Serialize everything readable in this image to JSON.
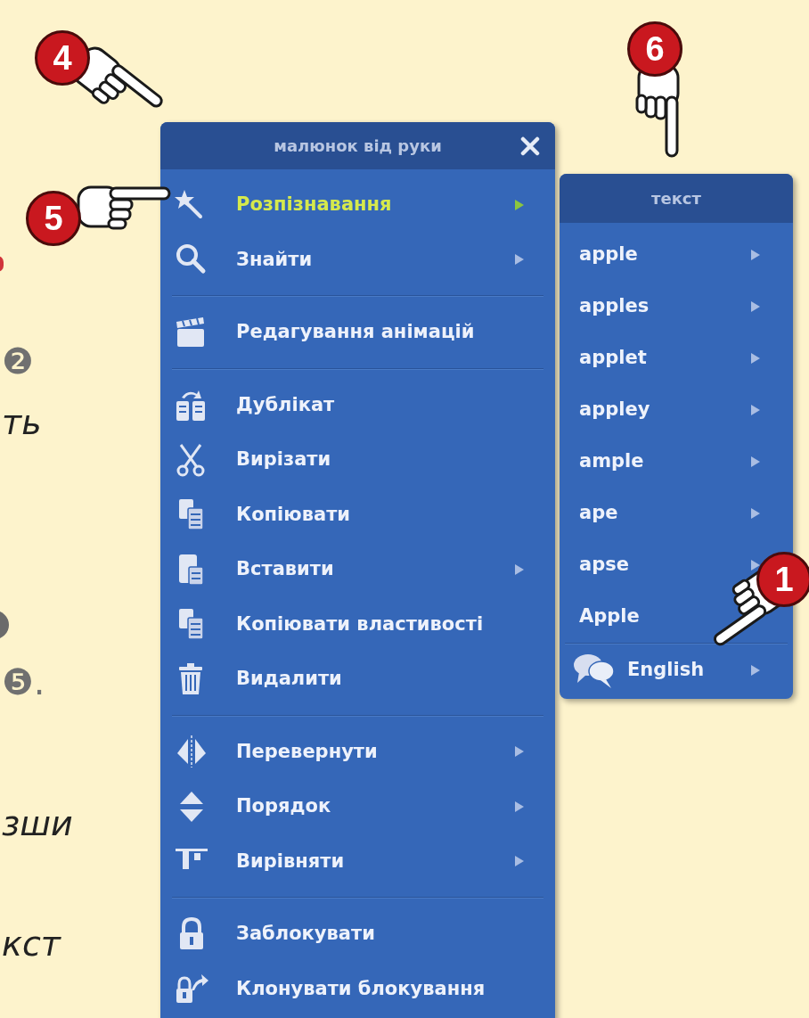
{
  "page_text_fragments": [
    {
      "text": "❷",
      "kind": "number"
    },
    {
      "text": "ть",
      "kind": "text"
    },
    {
      "text": "❺.",
      "kind": "number"
    },
    {
      "text": "зши",
      "kind": "text"
    },
    {
      "text": "кст",
      "kind": "text"
    }
  ],
  "callouts": [
    {
      "number": "4"
    },
    {
      "number": "6"
    },
    {
      "number": "5"
    },
    {
      "number": "1"
    }
  ],
  "main_menu": {
    "title": "малюнок від руки",
    "sections": [
      [
        {
          "label": "Розпізнавання",
          "has_submenu": true,
          "highlighted": true
        },
        {
          "label": "Знайти",
          "has_submenu": true,
          "highlighted": false
        }
      ],
      [
        {
          "label": "Редагування анімацій",
          "has_submenu": false,
          "highlighted": false
        }
      ],
      [
        {
          "label": "Дублікат",
          "has_submenu": false,
          "highlighted": false
        },
        {
          "label": "Вирізати",
          "has_submenu": false,
          "highlighted": false
        },
        {
          "label": "Копіювати",
          "has_submenu": false,
          "highlighted": false
        },
        {
          "label": "Вставити",
          "has_submenu": true,
          "highlighted": false
        },
        {
          "label": "Копіювати властивості",
          "has_submenu": false,
          "highlighted": false
        },
        {
          "label": "Видалити",
          "has_submenu": false,
          "highlighted": false
        }
      ],
      [
        {
          "label": "Перевернути",
          "has_submenu": true,
          "highlighted": false
        },
        {
          "label": "Порядок",
          "has_submenu": true,
          "highlighted": false
        },
        {
          "label": "Вирівняти",
          "has_submenu": true,
          "highlighted": false
        }
      ],
      [
        {
          "label": "Заблокувати",
          "has_submenu": false,
          "highlighted": false
        },
        {
          "label": "Клонувати блокування",
          "has_submenu": false,
          "highlighted": false
        }
      ]
    ]
  },
  "submenu": {
    "title": "текст",
    "sections": [
      [
        {
          "label": "apple",
          "has_submenu": true
        },
        {
          "label": "apples",
          "has_submenu": true
        },
        {
          "label": "applet",
          "has_submenu": true
        },
        {
          "label": "appley",
          "has_submenu": true
        },
        {
          "label": "ample",
          "has_submenu": true
        },
        {
          "label": "ape",
          "has_submenu": true
        },
        {
          "label": "apse",
          "has_submenu": true
        },
        {
          "label": "Apple",
          "has_submenu": false
        }
      ],
      [
        {
          "label": "English",
          "has_submenu": true
        }
      ]
    ]
  }
}
